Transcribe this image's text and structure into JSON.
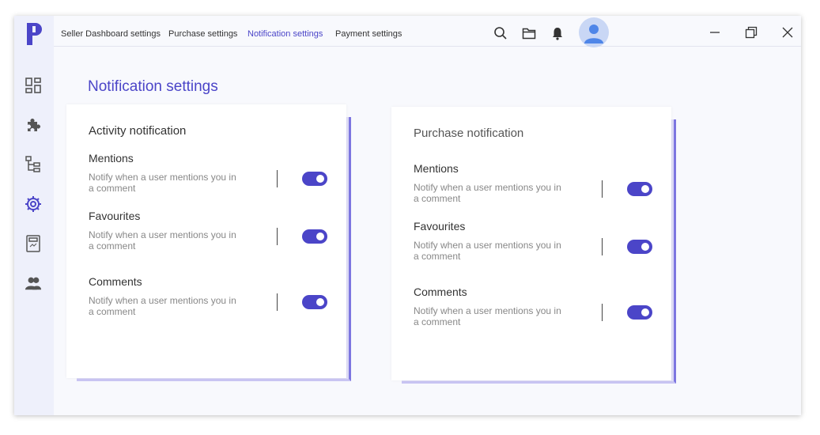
{
  "topbar": {
    "tabs": [
      {
        "label": "Seller Dashboard settings",
        "active": false
      },
      {
        "label": "Purchase settings",
        "active": false
      },
      {
        "label": "Notification settings",
        "active": true
      },
      {
        "label": "Payment settings",
        "active": false
      }
    ],
    "icons": [
      "search-icon",
      "folder-icon",
      "bell-icon",
      "avatar"
    ],
    "window_controls": [
      "minimize-icon",
      "restore-icon",
      "close-icon"
    ]
  },
  "sidebar": {
    "icons": [
      "dashboard-grid-icon",
      "puzzle-icon",
      "hierarchy-icon",
      "settings-gear-icon",
      "calculator-icon",
      "users-icon"
    ],
    "active": "settings-gear-icon"
  },
  "page": {
    "title": "Notification settings"
  },
  "cards": [
    {
      "title": "Activity notification",
      "rows": [
        {
          "title": "Mentions",
          "desc": "Notify when a user mentions you in a comment",
          "enabled": true
        },
        {
          "title": "Favourites",
          "desc": "Notify when a user mentions you in a comment",
          "enabled": true
        },
        {
          "title": "Comments",
          "desc": "Notify when a user mentions you in a comment",
          "enabled": true
        }
      ]
    },
    {
      "title": "Purchase notification",
      "rows": [
        {
          "title": "Mentions",
          "desc": "Notify when a user mentions you in a comment",
          "enabled": true
        },
        {
          "title": "Favourites",
          "desc": "Notify when a user mentions you in a comment",
          "enabled": true
        },
        {
          "title": "Comments",
          "desc": "Notify when a user mentions you in a comment",
          "enabled": true
        }
      ]
    }
  ],
  "colors": {
    "accent": "#4b45c8",
    "sidebar_bg": "#eef0fb",
    "page_bg": "#f8f9fd"
  }
}
